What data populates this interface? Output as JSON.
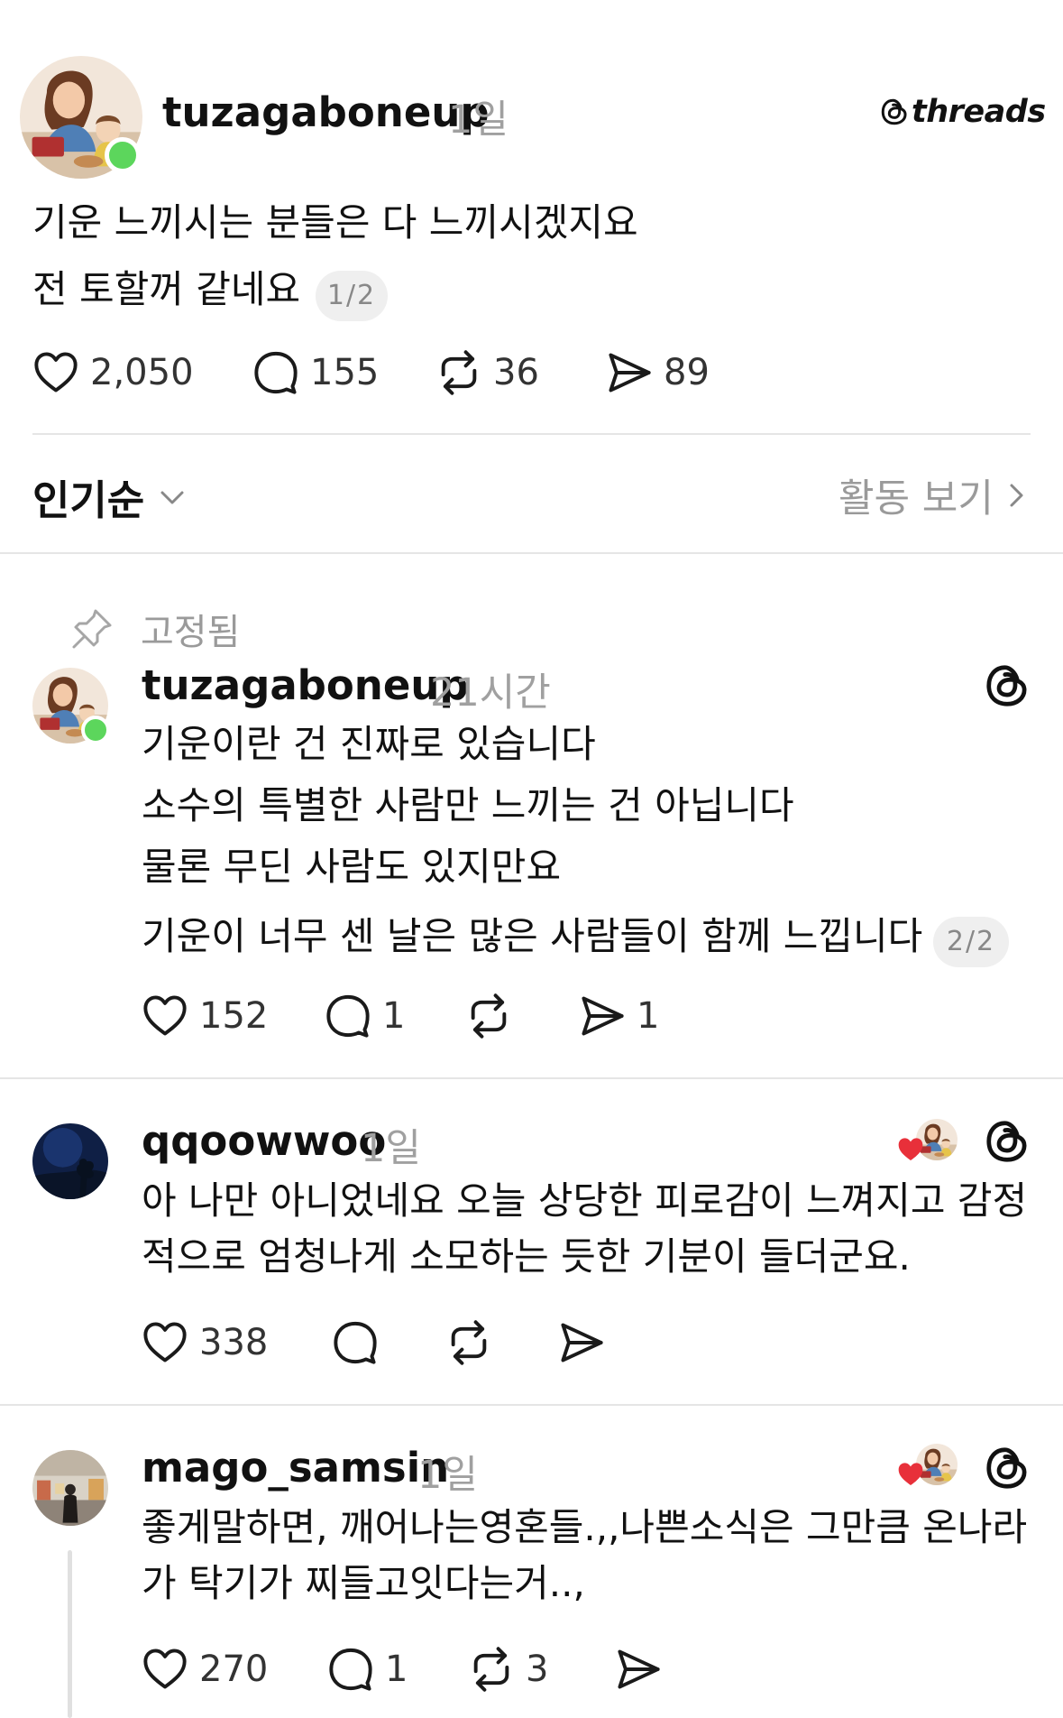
{
  "post": {
    "username": "tuzagaboneup",
    "time": "1일",
    "brand": "threads",
    "lines": [
      "기운 느끼시는 분들은 다 느끼시겠지요",
      "전 토할꺼 같네요"
    ],
    "page_indicator": "1/2",
    "likes": "2,050",
    "comments": "155",
    "reposts": "36",
    "shares": "89"
  },
  "sort": {
    "label": "인기순",
    "activity_label": "활동 보기"
  },
  "replies": [
    {
      "pinned_label": "고정됨",
      "username": "tuzagaboneup",
      "time": "21시간",
      "lines": [
        "기운이란 건 진짜로 있습니다",
        "소수의 특별한 사람만 느끼는 건 아닙니다",
        "물론 무딘 사람도 있지만요",
        "기운이 너무 센 날은 많은 사람들이 함께 느낍니다"
      ],
      "page_indicator": "2/2",
      "likes": "152",
      "comments": "1",
      "reposts": "",
      "shares": "1"
    },
    {
      "username": "qqoowwoo",
      "time": "1일",
      "lines": [
        "아 나만 아니었네요 오늘 상당한 피로감이 느껴지고 감정",
        "적으로 엄청나게 소모하는 듯한 기분이 들더군요."
      ],
      "likes": "338",
      "comments": "",
      "reposts": "",
      "shares": ""
    },
    {
      "username": "mago_samsin",
      "time": "1일",
      "lines": [
        "좋게말하면, 깨어나는영혼들.,,나쁜소식은 그만큼 온나라",
        "가 탁기가 찌들고잇다는거..,"
      ],
      "likes": "270",
      "comments": "1",
      "reposts": "3",
      "shares": ""
    }
  ],
  "colors": {
    "online": "#5cd65c",
    "heart_liked": "#e8303a",
    "muted_text": "#9a9a9a",
    "divider": "#e5e5e5"
  },
  "icons": [
    "heart-icon",
    "comment-icon",
    "repost-icon",
    "share-icon",
    "threads-logo-icon",
    "pin-icon",
    "chevron-down-icon",
    "chevron-right-icon"
  ]
}
